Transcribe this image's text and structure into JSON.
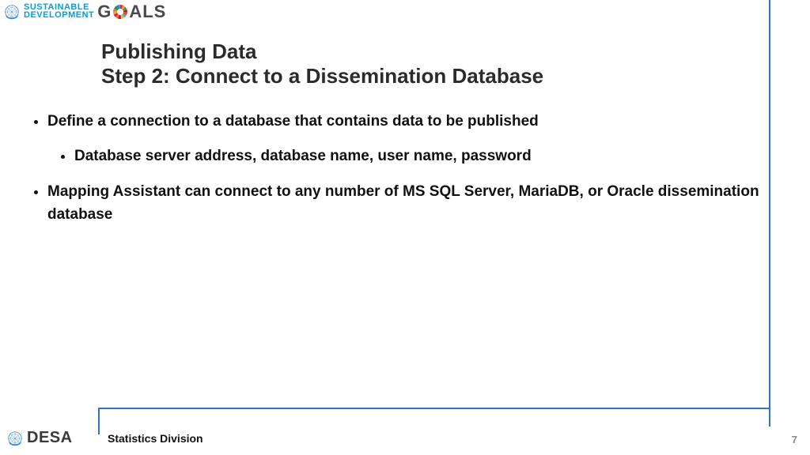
{
  "header": {
    "sdg_top": "SUSTAINABLE",
    "sdg_bottom": "DEVELOPMENT",
    "goals_word": "G   ALS"
  },
  "title": {
    "line1": "Publishing Data",
    "line2": "Step 2: Connect to a Dissemination Database"
  },
  "bullets": {
    "b1": "Define a connection to a database that contains data to be published",
    "b1_sub1": "Database server address, database name, user name, password",
    "b2": "Mapping Assistant can connect to any number of MS SQL Server, MariaDB, or Oracle dissemination database"
  },
  "footer": {
    "desa": "DESA",
    "division": "Statistics Division",
    "page": "7"
  },
  "colors": {
    "accent": "#2f75c0",
    "un_blue": "#3b8ad8"
  }
}
